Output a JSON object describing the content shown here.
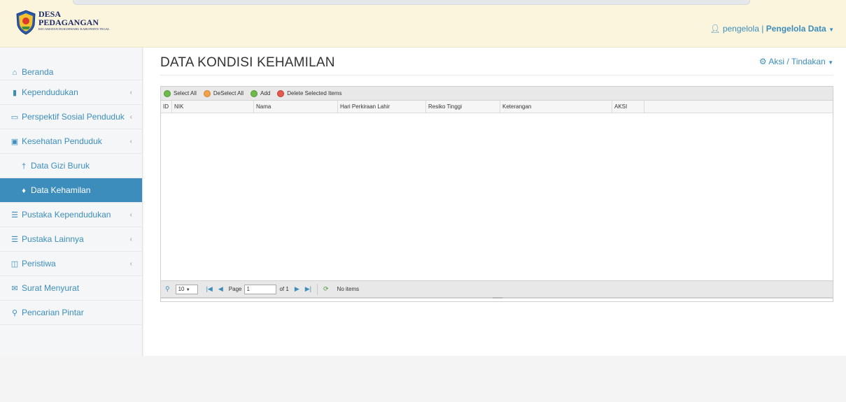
{
  "header": {
    "brand_line1": "DESA",
    "brand_line2": "PEDAGANGAN",
    "brand_line3": "KECAMATAN DUKUHWARU KABUPATEN TEGAL",
    "user_name": "pengelola",
    "user_separator": "|",
    "user_role": "Pengelola Data",
    "user_icon": "user-icon"
  },
  "sidebar": {
    "items": [
      {
        "label": "Beranda",
        "icon": "home-icon"
      },
      {
        "label": "Kependudukan",
        "icon": "book-icon"
      },
      {
        "label": "Perspektif Sosial Penduduk",
        "icon": "monitor-icon"
      },
      {
        "label": "Kesehatan Penduduk",
        "icon": "medkit-icon"
      },
      {
        "label": "Data Gizi Buruk",
        "icon": "male-icon"
      },
      {
        "label": "Data Kehamilan",
        "icon": "female-icon"
      },
      {
        "label": "Pustaka Kependudukan",
        "icon": "list-icon"
      },
      {
        "label": "Pustaka Lainnya",
        "icon": "list-icon"
      },
      {
        "label": "Peristiwa",
        "icon": "newspaper-icon"
      },
      {
        "label": "Surat Menyurat",
        "icon": "envelope-icon"
      },
      {
        "label": "Pencarian Pintar",
        "icon": "search-icon"
      }
    ]
  },
  "main": {
    "title": "DATA KONDISI KEHAMILAN",
    "actions_label": "Aksi / Tindakan"
  },
  "toolbar": {
    "select_all": "Select All",
    "deselect_all": "DeSelect All",
    "add": "Add",
    "delete_selected": "Delete Selected Items"
  },
  "table": {
    "columns": [
      "ID",
      "NIK",
      "Nama",
      "Hari Perkiraan Lahir",
      "Resiko Tinggi",
      "Keterangan",
      "AKSI"
    ]
  },
  "pager": {
    "page_size": "10",
    "page_label": "Page",
    "page_value": "1",
    "of_label": "of 1",
    "status": "No items"
  },
  "colors": {
    "accent": "#3c8dbc",
    "header_bg": "#fbf5dd",
    "active_bg": "#3c8dbc"
  }
}
